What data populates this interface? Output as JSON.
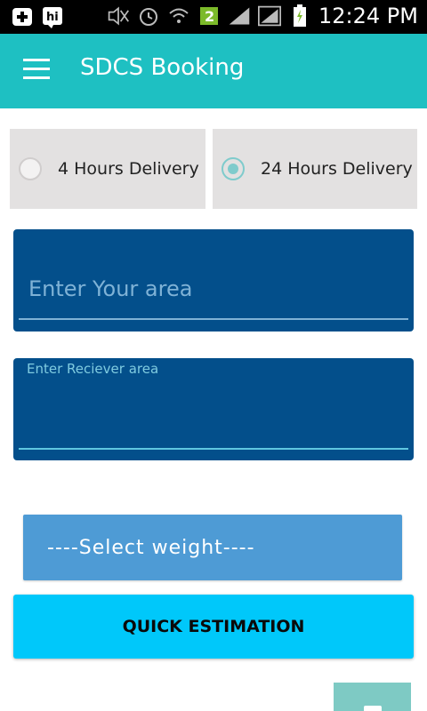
{
  "statusbar": {
    "time": "12:24 PM",
    "battery_badge": "2"
  },
  "appbar": {
    "title": "SDCS Booking"
  },
  "delivery_options": [
    {
      "label": "4 Hours Delivery",
      "checked": false
    },
    {
      "label": "24 Hours Delivery",
      "checked": true
    }
  ],
  "area_field": {
    "placeholder": "Enter Your area",
    "value": ""
  },
  "receiver_field": {
    "label": "Enter Reciever area",
    "value": ""
  },
  "weight_select": {
    "selected": "----Select weight----"
  },
  "quick_button": {
    "label": "QUICK ESTIMATION"
  },
  "colors": {
    "appbar": "#1ec0c2",
    "field_bg": "#034f8b",
    "select_bg": "#4e9bd5",
    "button_bg": "#00c8fa",
    "radio_accent": "#7fcbcc"
  }
}
